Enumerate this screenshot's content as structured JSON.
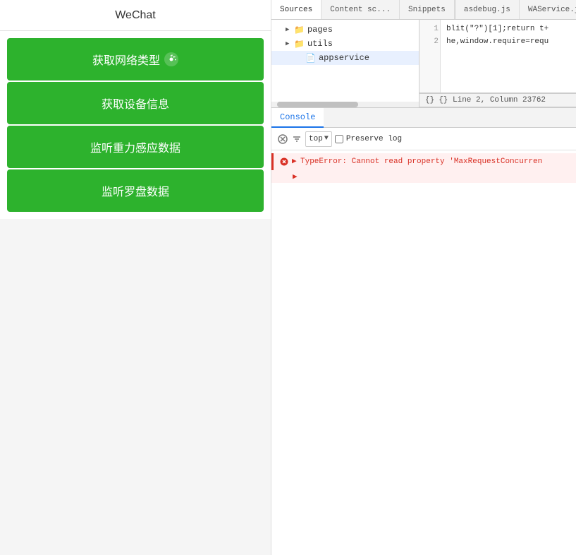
{
  "wechat": {
    "title": "WeChat",
    "buttons": [
      {
        "label": "获取网络类型",
        "hasIcon": true
      },
      {
        "label": "获取设备信息",
        "hasIcon": false
      },
      {
        "label": "监听重力感应数据",
        "hasIcon": false
      },
      {
        "label": "监听罗盘数据",
        "hasIcon": false
      }
    ]
  },
  "devtools": {
    "top_tabs": [
      {
        "label": "Sources",
        "active": true
      },
      {
        "label": "Content sc...",
        "active": false
      },
      {
        "label": "Snippets",
        "active": false
      }
    ],
    "right_tabs": [
      {
        "label": "asdebug.js"
      },
      {
        "label": "WAService.js"
      }
    ],
    "file_tree": [
      {
        "type": "folder",
        "name": "pages",
        "indent": 1,
        "expanded": false
      },
      {
        "type": "folder",
        "name": "utils",
        "indent": 1,
        "expanded": false
      },
      {
        "type": "file",
        "name": "appservice",
        "indent": 2,
        "selected": true
      }
    ],
    "code_lines": [
      {
        "num": "1",
        "text": "blit(\"?\")[1];return t+"
      },
      {
        "num": "2",
        "text": "he,window.require=requ"
      }
    ],
    "status_bar": {
      "text": "{}  Line 2, Column 23762"
    },
    "console": {
      "tab_label": "Console",
      "toolbar": {
        "level_select": "top",
        "preserve_log": "Preserve log"
      },
      "messages": [
        {
          "type": "error",
          "text": "TypeError: Cannot read property 'MaxRequestConcurren",
          "has_continuation": true
        }
      ]
    }
  }
}
